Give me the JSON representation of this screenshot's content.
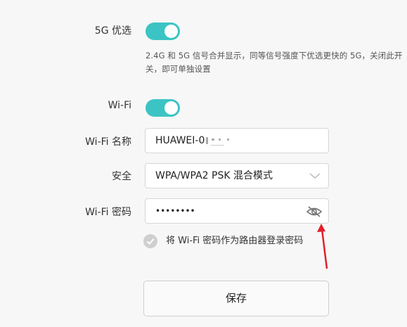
{
  "band_5g": {
    "label": "5G 优选",
    "enabled": true,
    "hint": "2.4G 和 5G 信号合并显示，同等信号强度下优选更快的 5G，关闭此开关，即可单独设置"
  },
  "wifi": {
    "label": "Wi-Fi",
    "enabled": true
  },
  "wifi_name": {
    "label": "Wi-Fi 名称",
    "value": "HUAWEI-0"
  },
  "security": {
    "label": "安全",
    "selected": "WPA/WPA2 PSK 混合模式"
  },
  "wifi_password": {
    "label": "Wi-Fi 密码",
    "value": "••••••••",
    "toggle_icon": "eye-slash-icon"
  },
  "router_password_option": {
    "label": "将 Wi-Fi 密码作为路由器登录密码",
    "checked": true
  },
  "save_button": {
    "label": "保存"
  },
  "colors": {
    "toggle_on": "#3cc4c4",
    "annotation_arrow": "#e0202a"
  }
}
